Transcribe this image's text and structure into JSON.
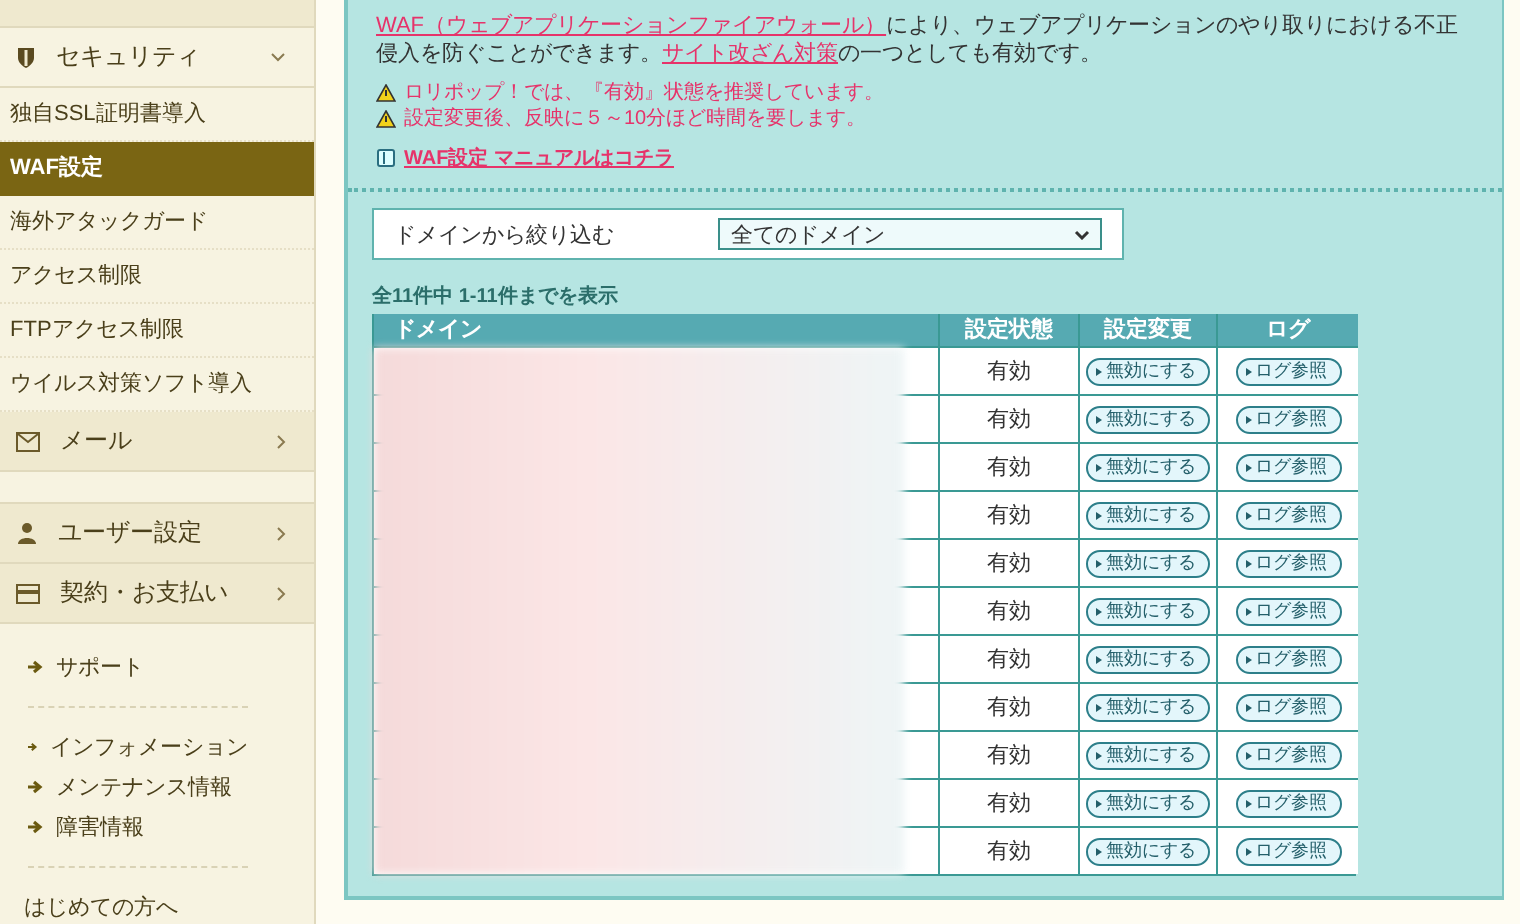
{
  "sidebar": {
    "menus": [
      {
        "label": "セキュリティ",
        "expanded": true,
        "items": [
          {
            "label": "独自SSL証明書導入",
            "selected": false
          },
          {
            "label": "WAF設定",
            "selected": true
          },
          {
            "label": "海外アタックガード",
            "selected": false
          },
          {
            "label": "アクセス制限",
            "selected": false
          },
          {
            "label": "FTPアクセス制限",
            "selected": false
          },
          {
            "label": "ウイルス対策ソフト導入",
            "selected": false
          }
        ]
      },
      {
        "label": "メール",
        "expanded": false
      },
      {
        "label": "ユーザー設定",
        "expanded": false
      },
      {
        "label": "契約・お支払い",
        "expanded": false
      }
    ],
    "link_groups": [
      [
        "サポート"
      ],
      [
        "インフォメーション",
        "メンテナンス情報",
        "障害情報"
      ]
    ],
    "footer_link": "はじめての方へ"
  },
  "main": {
    "intro": [
      {
        "text": "WAF（ウェブアプリケーションファイアウォール）",
        "link": true
      },
      {
        "text": "により、ウェブアプリケーションのやり取りにおける不正侵入を防ぐことができます。",
        "link": false
      },
      {
        "text": "サイト改ざん対策",
        "link": true
      },
      {
        "text": "の一つとしても有効です。",
        "link": false
      }
    ],
    "warnings": [
      "ロリポップ！では、『有効』状態を推奨しています。",
      "設定変更後、反映に５～10分ほど時間を要します。"
    ],
    "manual_link": "WAF設定 マニュアルはコチラ",
    "filter": {
      "label": "ドメインから絞り込む",
      "value": "全てのドメイン"
    },
    "count": "全11件中 1-11件までを表示",
    "table": {
      "columns": [
        "ドメイン",
        "設定状態",
        "設定変更",
        "ログ"
      ],
      "rows": [
        {
          "status": "有効",
          "change": "無効にする",
          "log": "ログ参照"
        },
        {
          "status": "有効",
          "change": "無効にする",
          "log": "ログ参照"
        },
        {
          "status": "有効",
          "change": "無効にする",
          "log": "ログ参照"
        },
        {
          "status": "有効",
          "change": "無効にする",
          "log": "ログ参照"
        },
        {
          "status": "有効",
          "change": "無効にする",
          "log": "ログ参照"
        },
        {
          "status": "有効",
          "change": "無効にする",
          "log": "ログ参照"
        },
        {
          "status": "有効",
          "change": "無効にする",
          "log": "ログ参照"
        },
        {
          "status": "有効",
          "change": "無効にする",
          "log": "ログ参照"
        },
        {
          "status": "有効",
          "change": "無効にする",
          "log": "ログ参照"
        },
        {
          "status": "有効",
          "change": "無効にする",
          "log": "ログ参照"
        },
        {
          "status": "有効",
          "change": "無効にする",
          "log": "ログ参照"
        }
      ]
    }
  }
}
